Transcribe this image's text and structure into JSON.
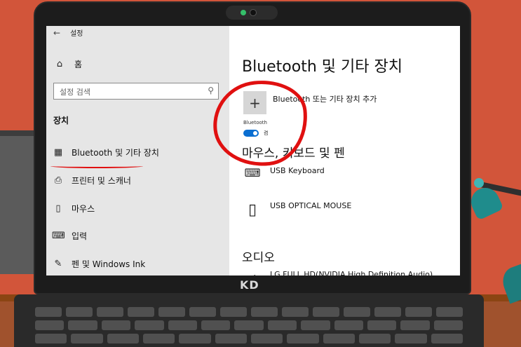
{
  "window": {
    "back_glyph": "←",
    "title": "설정"
  },
  "sidebar": {
    "home": {
      "icon": "home-icon",
      "glyph": "⌂",
      "label": "홈"
    },
    "search": {
      "placeholder": "설정 검색",
      "icon": "search-icon",
      "glyph": "⚲"
    },
    "section_title": "장치",
    "items": [
      {
        "icon": "bluetooth-device-icon",
        "glyph": "▦",
        "label": "Bluetooth 및 기타 장치",
        "selected": true
      },
      {
        "icon": "printer-icon",
        "glyph": "⎙",
        "label": "프린터 및 스캐너"
      },
      {
        "icon": "mouse-icon",
        "glyph": "▯",
        "label": "마우스"
      },
      {
        "icon": "keyboard-icon",
        "glyph": "⌨",
        "label": "입력"
      },
      {
        "icon": "pen-icon",
        "glyph": "✎",
        "label": "펜 및 Windows Ink"
      }
    ]
  },
  "content": {
    "title": "Bluetooth 및 기타 장치",
    "add_device": {
      "glyph": "+",
      "label": "Bluetooth 또는 기타 장치 추가"
    },
    "bluetooth": {
      "caption": "Bluetooth",
      "toggle_state": "켬",
      "on": true
    },
    "mouse_keyboard_title": "마우스, 키보드 및 펜",
    "devices": [
      {
        "icon": "keyboard-icon",
        "glyph": "⌨",
        "name": "USB Keyboard"
      },
      {
        "icon": "mouse-icon",
        "glyph": "▯",
        "name": "USB OPTICAL MOUSE"
      }
    ],
    "audio_title": "오디오",
    "audio_devices": [
      {
        "icon": "speaker-icon",
        "glyph": "◂",
        "name": "LG FULL HD(NVIDIA High Definition Audio)"
      }
    ]
  },
  "laptop": {
    "brand": "KD"
  },
  "colors": {
    "accent": "#0a6ed1",
    "annotation": "#e01010",
    "wall": "#d2553a"
  }
}
